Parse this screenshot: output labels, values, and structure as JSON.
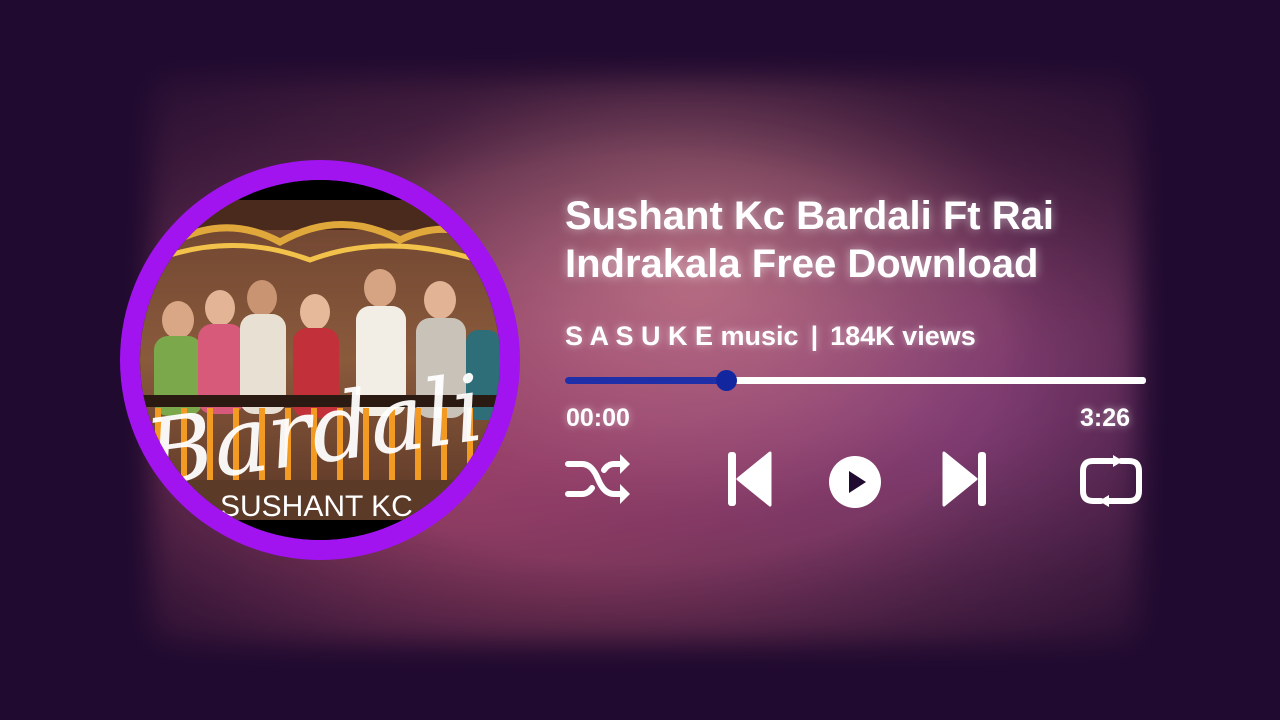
{
  "song": {
    "title": "Sushant Kc Bardali Ft Rai Indrakala Free Download",
    "artist": "S A S U K E music",
    "separator": "|",
    "views": "184K views"
  },
  "cover": {
    "script_title": "Bardali",
    "artist_caption": "SUSHANT KC"
  },
  "player": {
    "current_time": "00:00",
    "duration": "3:26",
    "progress_fraction": 0.277
  },
  "controls": {
    "shuffle_icon": "shuffle-icon",
    "previous_icon": "skip-previous-icon",
    "play_icon": "play-circle-icon",
    "next_icon": "skip-next-icon",
    "repeat_icon": "repeat-icon"
  },
  "colors": {
    "background": "#200a2f",
    "ring": "#a114f0",
    "progress_fill": "#1e2fa8",
    "knob": "#1226a0"
  }
}
